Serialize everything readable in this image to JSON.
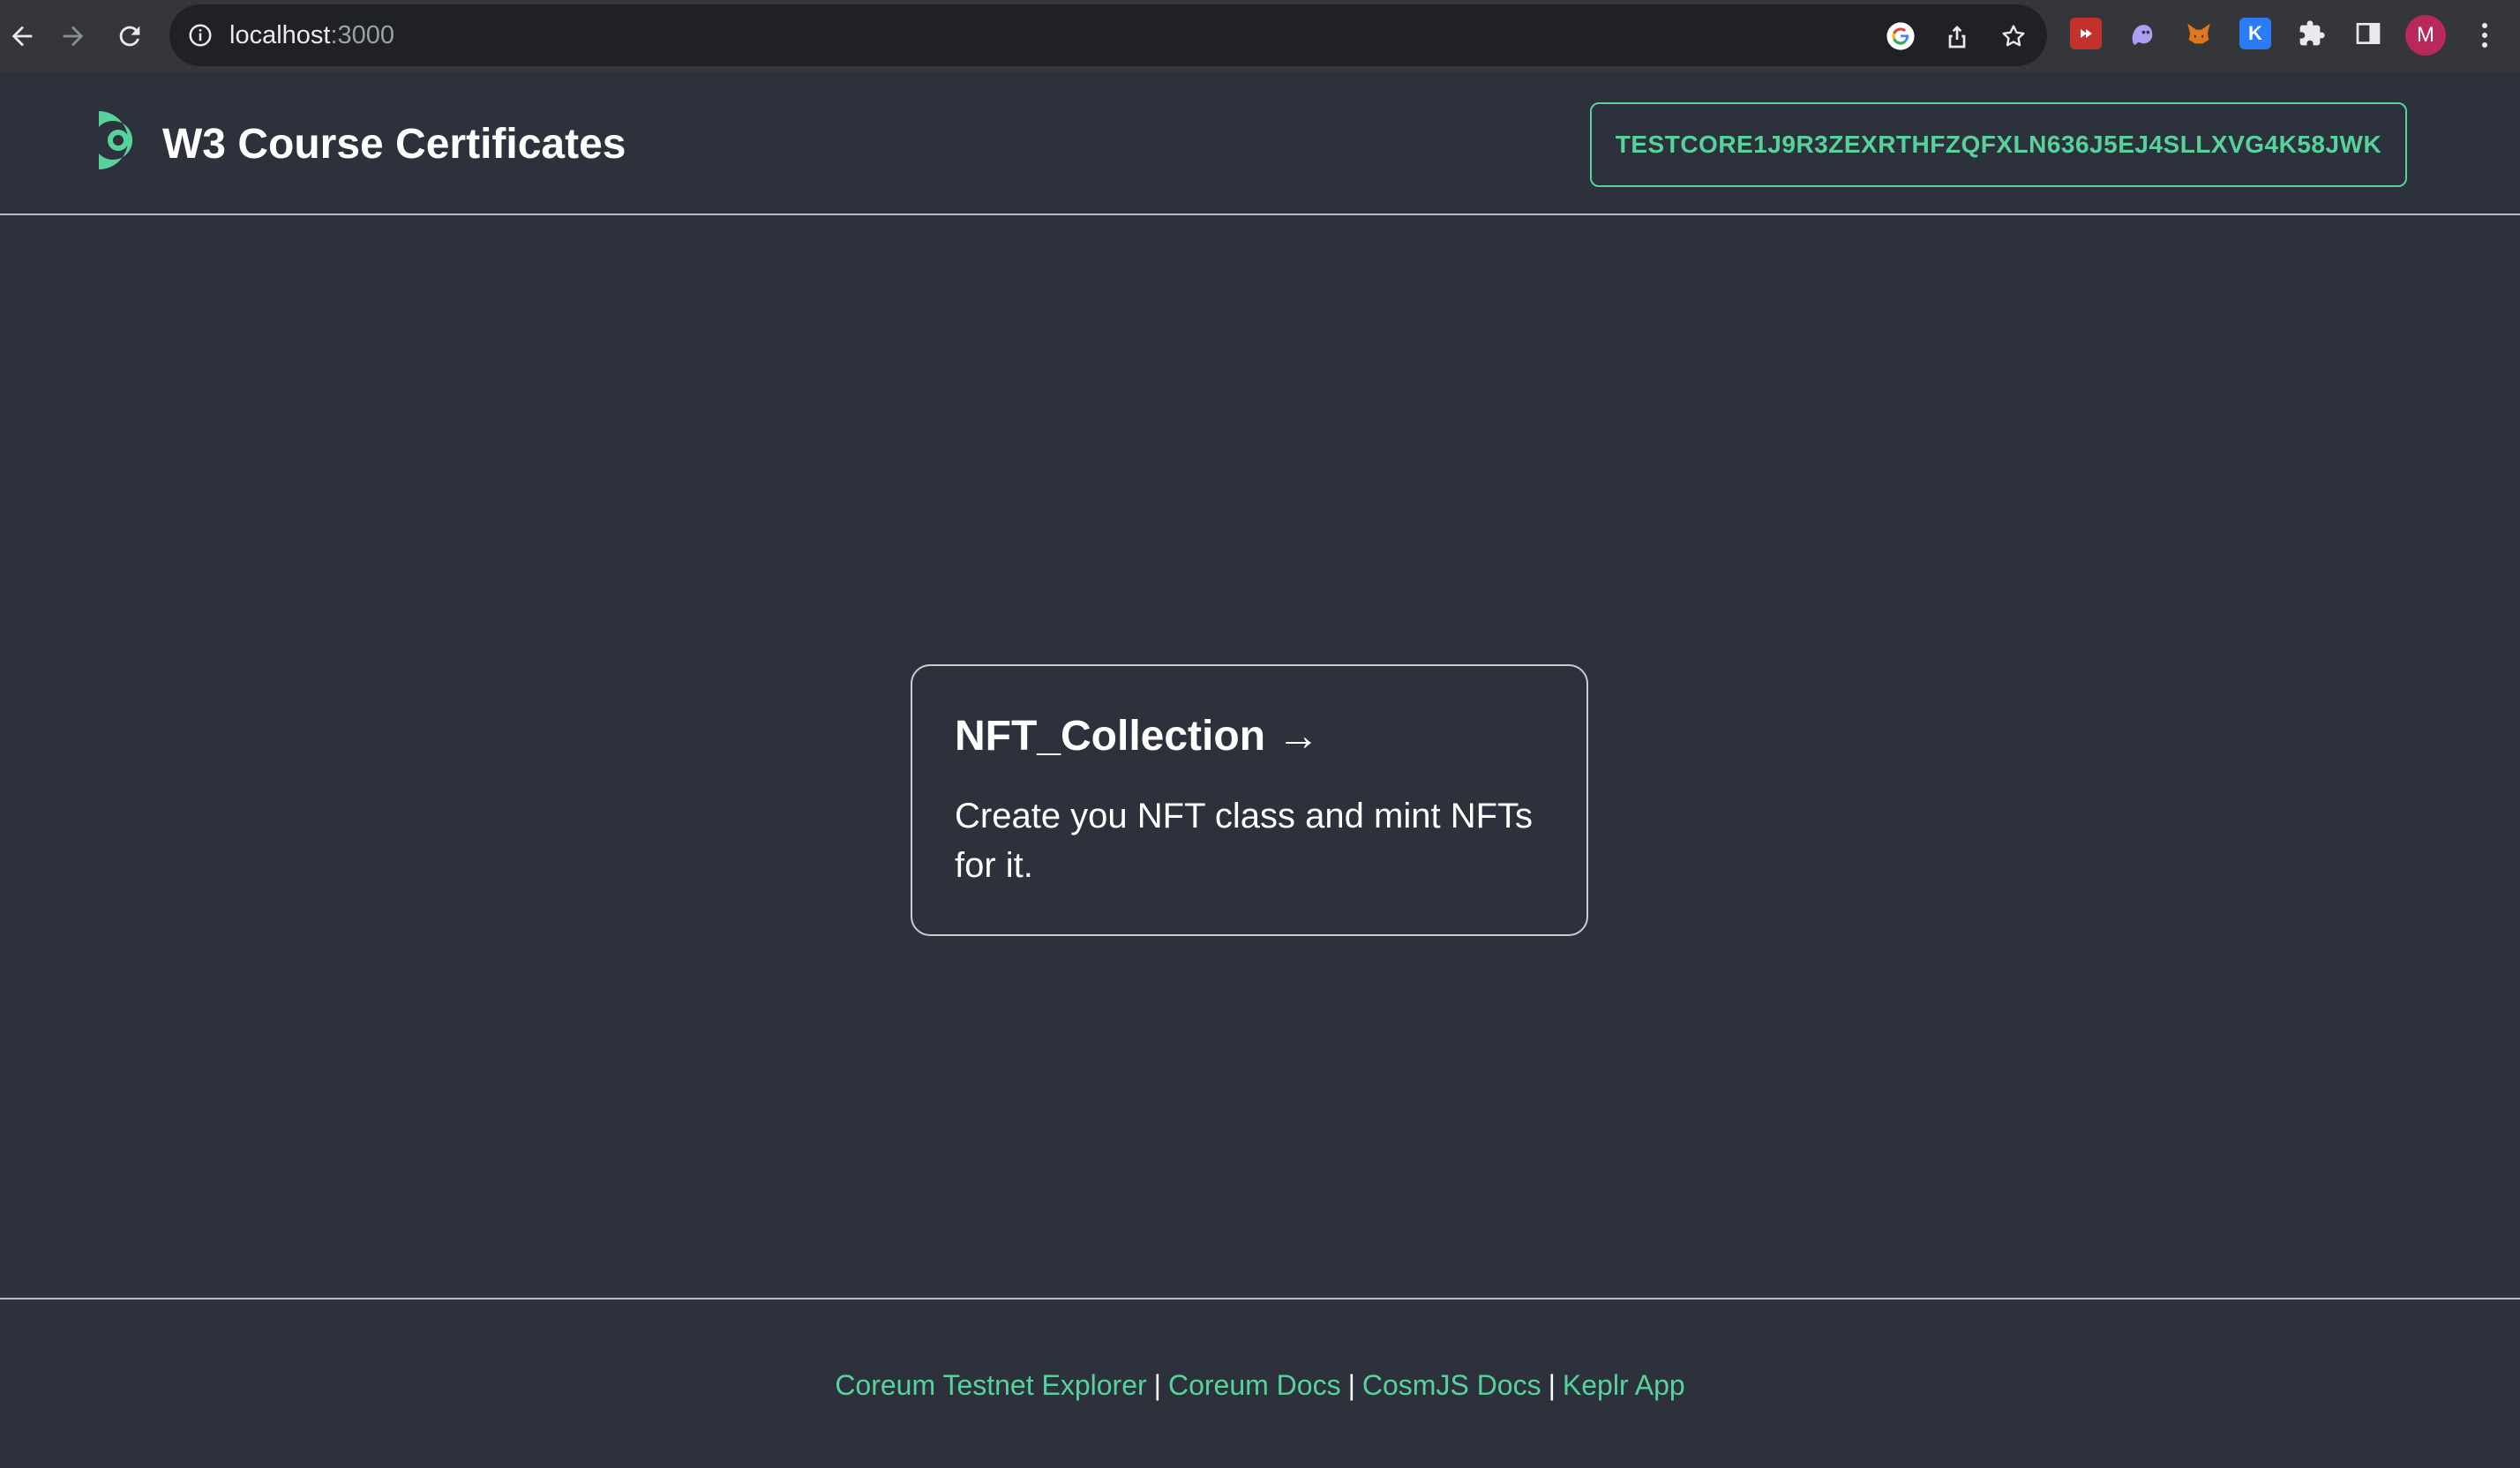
{
  "browser": {
    "url_host": "localhost",
    "url_port": ":3000",
    "avatar_letter": "M",
    "ext_k_letter": "K"
  },
  "header": {
    "title": "W3 Course Certificates",
    "wallet_address": "TESTCORE1J9R3ZEXRTHFZQFXLN636J5EJ4SLLXVG4K58JWK"
  },
  "card": {
    "title": "NFT_Collection →",
    "description": "Create you NFT class and mint NFTs for it."
  },
  "footer": {
    "links": [
      {
        "label": "Coreum Testnet Explorer"
      },
      {
        "label": "Coreum Docs"
      },
      {
        "label": "CosmJS Docs"
      },
      {
        "label": "Keplr App"
      }
    ],
    "separator": "|"
  },
  "colors": {
    "background": "#2d313c",
    "accent": "#58d29b",
    "chrome": "#35363a"
  }
}
